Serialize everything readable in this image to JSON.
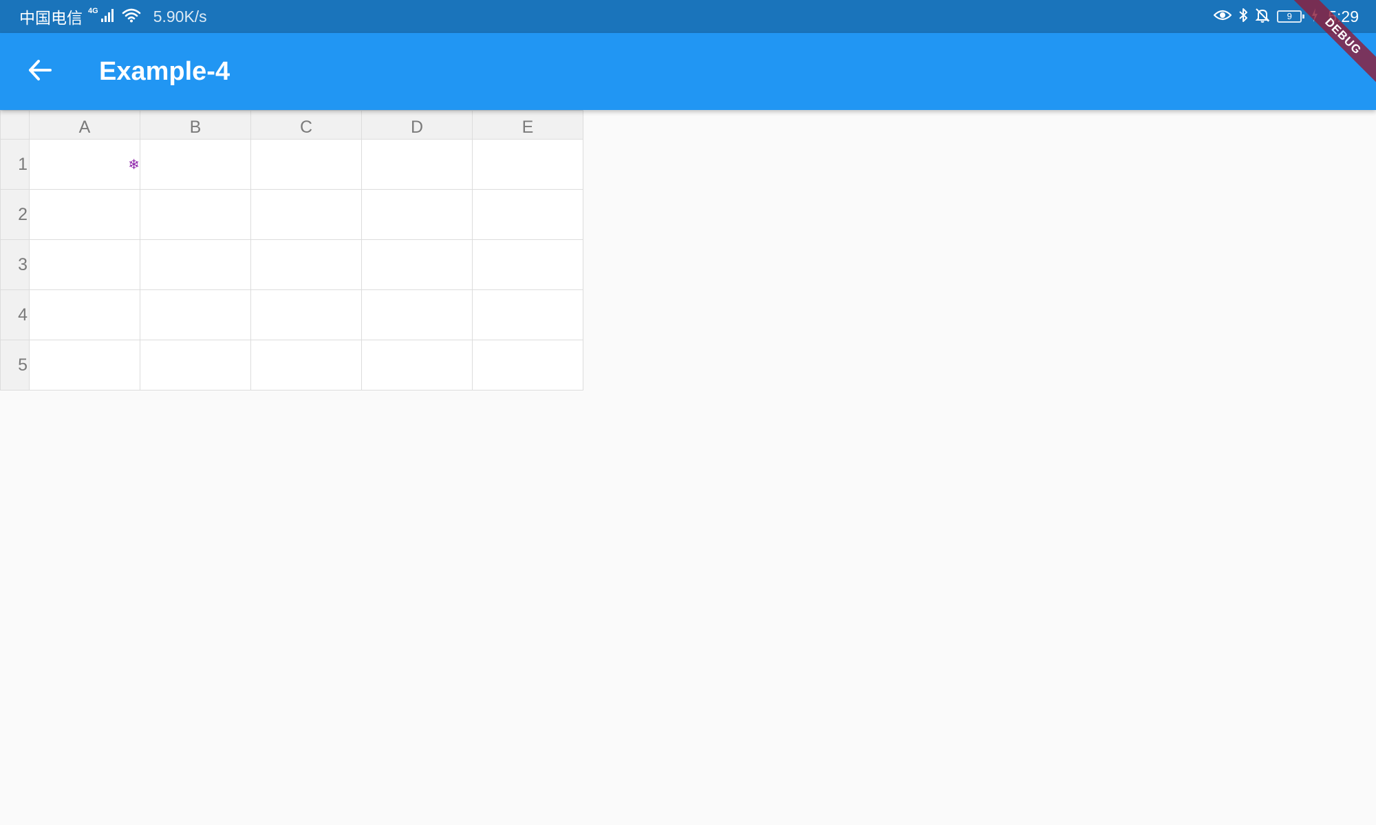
{
  "status_bar": {
    "carrier": "中国电信",
    "network_type": "4G",
    "speed": "5.90K/s",
    "battery_level": "9",
    "time": "5:29",
    "icons": [
      "signal-icon",
      "wifi-icon",
      "eye-icon",
      "bluetooth-icon",
      "bell-off-icon",
      "battery-icon",
      "charging-icon"
    ],
    "background_color": "#1a74bb"
  },
  "app_bar": {
    "title": "Example-4",
    "back_icon": "arrow-back-icon",
    "background_color": "#2196f3"
  },
  "debug_banner": "DEBUG",
  "sheet": {
    "columns": [
      "A",
      "B",
      "C",
      "D",
      "E"
    ],
    "rows": [
      "1",
      "2",
      "3",
      "4",
      "5"
    ],
    "cell_marker": {
      "cell": "A1",
      "symbol": "❄",
      "color": "#8e24aa",
      "icon": "snowflake-icon"
    }
  }
}
